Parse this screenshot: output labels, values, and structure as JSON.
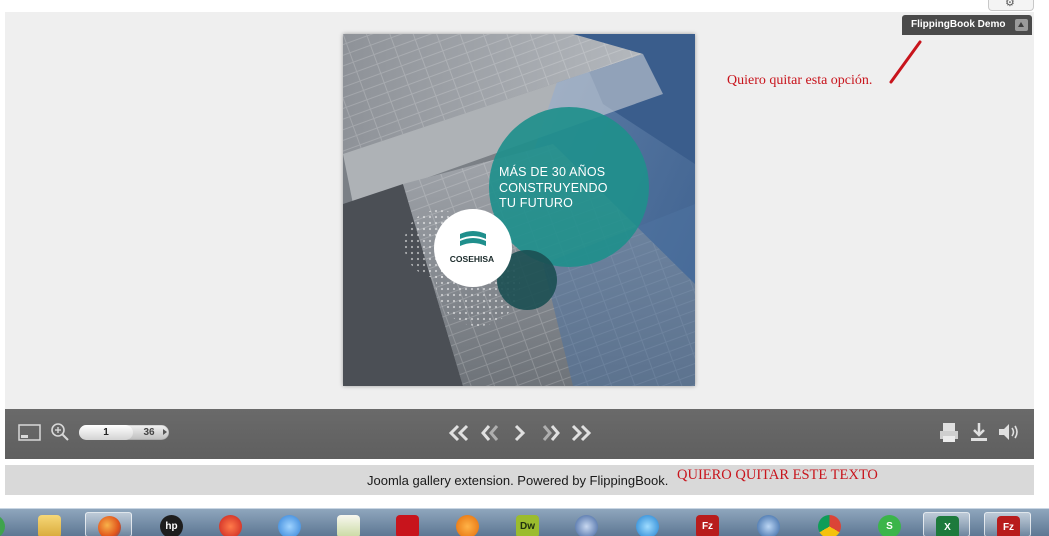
{
  "viewer": {
    "demo_badge": "FlippingBook Demo",
    "annotation_top": "Quiero quitar esta opción."
  },
  "page": {
    "headline_lines": [
      "MÁS DE 30 AÑOS",
      "CONSTRUYENDO",
      "TU FUTURO"
    ],
    "logo_text": "COSEHISA",
    "colors": {
      "teal": "#1f8f8c",
      "dark_teal": "#1b4f52",
      "building": "#8a9096",
      "sky": "#4a6f9c"
    }
  },
  "toolbar": {
    "current_page": "1",
    "total_pages": "36",
    "icons": [
      "thumbnails-icon",
      "zoom-icon",
      "first-page-icon",
      "previous-page-icon",
      "next-page-icon",
      "forward-icon",
      "last-page-icon",
      "print-icon",
      "download-icon",
      "sound-icon"
    ]
  },
  "footer": {
    "text": "Joomla gallery extension. Powered by FlippingBook.",
    "annotation": "QUIERO  QUITAR ESTE TEXTO"
  },
  "taskbar": {
    "items": [
      {
        "icon": "app-icon",
        "label": ""
      },
      {
        "icon": "folder-icon",
        "label": ""
      },
      {
        "icon": "firefox-icon",
        "label": ""
      },
      {
        "icon": "hp-icon",
        "label": "hp"
      },
      {
        "icon": "burn-icon",
        "label": ""
      },
      {
        "icon": "itunes-icon",
        "label": ""
      },
      {
        "icon": "notepad-plus-icon",
        "label": ""
      },
      {
        "icon": "acrobat-icon",
        "label": ""
      },
      {
        "icon": "media-player-icon",
        "label": ""
      },
      {
        "icon": "dreamweaver-icon",
        "label": "Dw"
      },
      {
        "icon": "network-icon",
        "label": ""
      },
      {
        "icon": "internet-explorer-icon",
        "label": ""
      },
      {
        "icon": "filezilla-icon",
        "label": "Fz"
      },
      {
        "icon": "thunderbird-icon",
        "label": ""
      },
      {
        "icon": "chrome-icon",
        "label": ""
      },
      {
        "icon": "skype-icon",
        "label": "S"
      },
      {
        "icon": "excel-icon",
        "label": "X"
      },
      {
        "icon": "filezilla-icon-2",
        "label": "Fz"
      }
    ]
  }
}
